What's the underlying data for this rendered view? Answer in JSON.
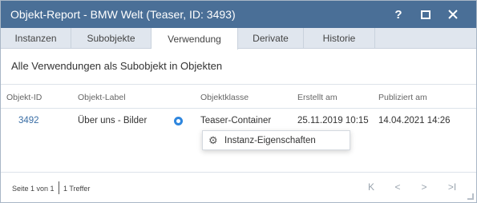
{
  "window": {
    "title": "Objekt-Report - BMW Welt (Teaser, ID: 3493)",
    "help_label": "?",
    "help_icon": "help-icon",
    "maximize_icon": "maximize-icon",
    "close_icon": "close-icon"
  },
  "tabs": [
    {
      "label": "Instanzen",
      "active": false
    },
    {
      "label": "Subobjekte",
      "active": false
    },
    {
      "label": "Verwendung",
      "active": true
    },
    {
      "label": "Derivate",
      "active": false
    },
    {
      "label": "Historie",
      "active": false
    }
  ],
  "section_title": "Alle Verwendungen als Subobjekt in Objekten",
  "table": {
    "columns": [
      "Objekt-ID",
      "Objekt-Label",
      "Objektklasse",
      "Erstellt am",
      "Publiziert am"
    ],
    "rows": [
      {
        "id": "3492",
        "label": "Über uns - Bilder",
        "class": "Teaser-Container",
        "created": "25.11.2019 10:15",
        "published": "14.04.2021 14:26",
        "icon": "radio-target-icon"
      }
    ]
  },
  "context_menu": {
    "items": [
      {
        "label": "Instanz-Eigenschaften",
        "icon": "gear-icon"
      }
    ]
  },
  "footer": {
    "page_info": "Seite 1 von 1",
    "hit_count": "1 Treffer",
    "first_label": "K",
    "prev_label": "<",
    "next_label": ">",
    "last_label": ">I"
  },
  "colors": {
    "titlebar": "#4a6f97",
    "tabbar": "#e0e6ee",
    "link": "#3a6ea5",
    "accent_icon": "#2e86de"
  }
}
